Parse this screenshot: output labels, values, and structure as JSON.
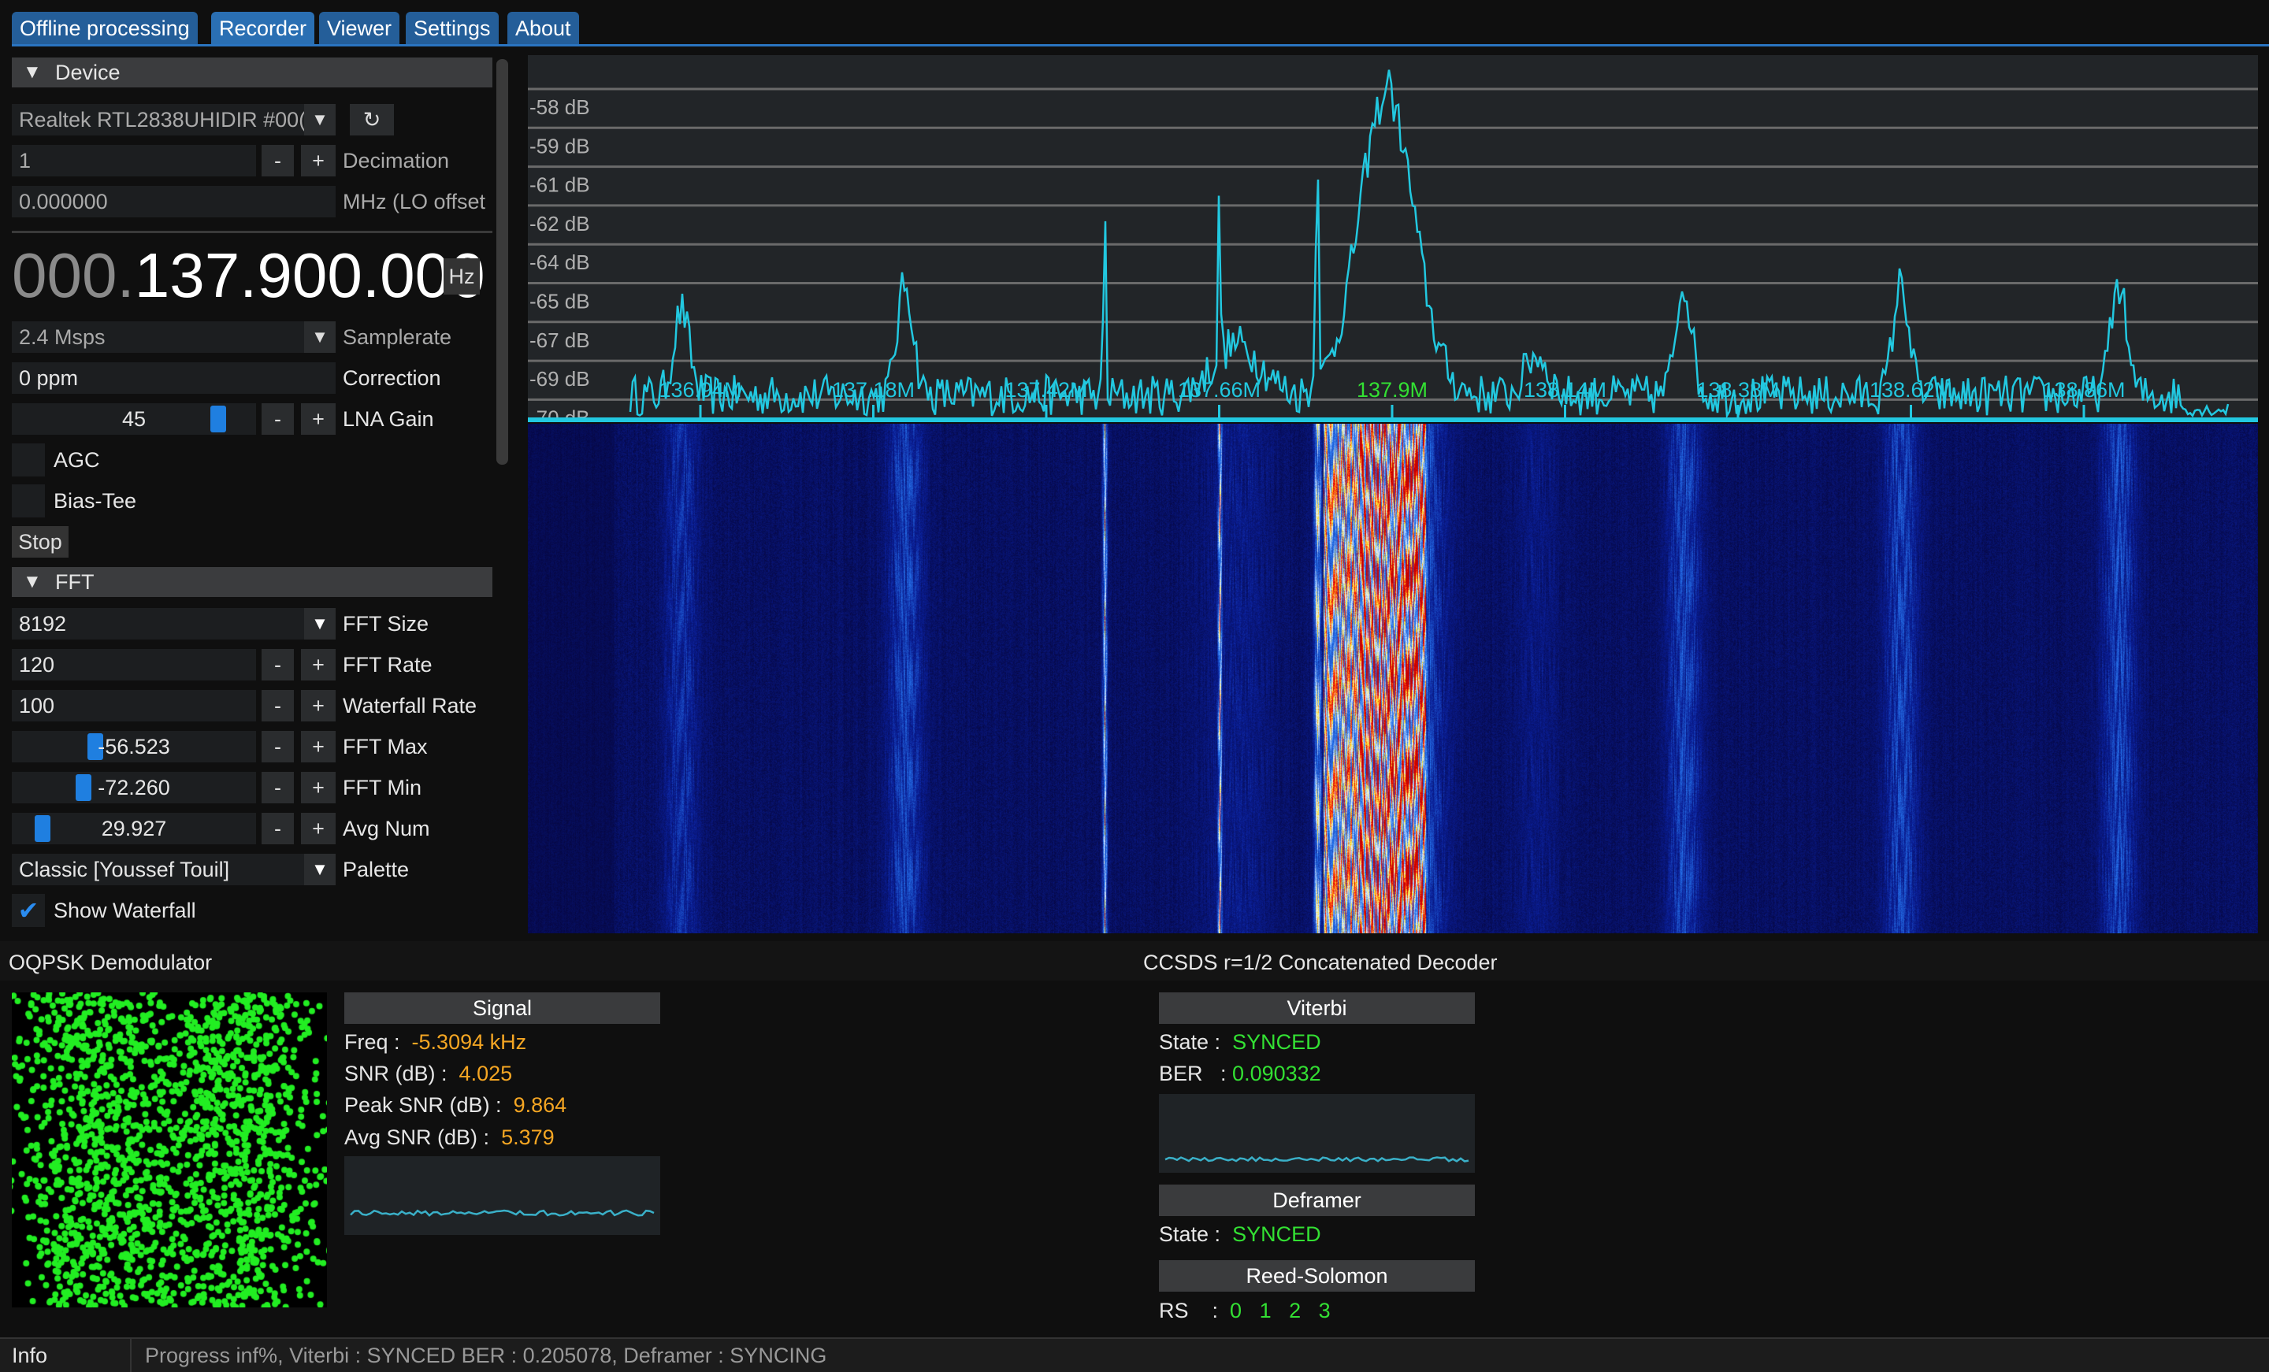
{
  "tabs": [
    {
      "label": "Offline processing"
    },
    {
      "label": "Recorder"
    },
    {
      "label": "Viewer"
    },
    {
      "label": "Settings"
    },
    {
      "label": "About"
    }
  ],
  "device": {
    "header": "Device",
    "source": "Realtek RTL2838UHIDIR #00(",
    "refresh_icon": "refresh-icon",
    "decimation": {
      "value": "1",
      "label": "Decimation"
    },
    "lo_offset": {
      "value": "0.000000",
      "label": "MHz (LO offset"
    },
    "frequency": {
      "leading": "000.",
      "main": "137.900.000",
      "unit": "Hz"
    },
    "samplerate": {
      "value": "2.4 Msps",
      "label": "Samplerate"
    },
    "correction": {
      "value": "0 ppm",
      "label": "Correction"
    },
    "lna_gain": {
      "value": "45",
      "label": "LNA Gain",
      "level": 0.87
    },
    "agc": {
      "label": "AGC",
      "checked": false
    },
    "bias_tee": {
      "label": "Bias-Tee",
      "checked": false
    },
    "stop_label": "Stop"
  },
  "fft": {
    "header": "FFT",
    "size": {
      "value": "8192",
      "label": "FFT Size"
    },
    "rate": {
      "value": "120",
      "label": "FFT Rate"
    },
    "waterfall_rate": {
      "value": "100",
      "label": "Waterfall Rate"
    },
    "max": {
      "value": "-56.523",
      "label": "FFT Max",
      "level": 0.33
    },
    "min": {
      "value": "-72.260",
      "label": "FFT Min",
      "level": 0.28
    },
    "avg": {
      "value": "29.927",
      "label": "Avg Num",
      "level": 0.1
    },
    "palette": {
      "value": "Classic [Youssef Touil]",
      "label": "Palette"
    },
    "show_waterfall": {
      "label": "Show Waterfall",
      "checked": true
    }
  },
  "spectrum": {
    "db_labels": [
      "-58 dB",
      "-59 dB",
      "-61 dB",
      "-62 dB",
      "-64 dB",
      "-65 dB",
      "-67 dB",
      "-69 dB",
      "-70 dB"
    ],
    "freq_labels": [
      "136.94M",
      "137.18M",
      "137.42M",
      "137.66M",
      "137.9M",
      "138.14M",
      "138.38M",
      "138.62M",
      "138.86M"
    ],
    "center_label_index": 4,
    "line_color": "#22c8e0",
    "center_color": "#33e033"
  },
  "demod": {
    "title": "OQPSK Demodulator",
    "signal_label": "Signal",
    "rows": [
      {
        "key": "Freq :",
        "value": "-5.3094 kHz"
      },
      {
        "key": "SNR (dB) :",
        "value": "4.025"
      },
      {
        "key": "Peak SNR (dB) :",
        "value": "9.864"
      },
      {
        "key": "Avg SNR (dB) :",
        "value": "5.379"
      }
    ]
  },
  "decoder": {
    "title": "CCSDS r=1/2 Concatenated Decoder",
    "viterbi_label": "Viterbi",
    "viterbi_state_key": "State :",
    "viterbi_state": "SYNCED",
    "ber_key": "BER   :",
    "ber": "0.090332",
    "deframer_label": "Deframer",
    "deframer_state_key": "State :",
    "deframer_state": "SYNCED",
    "rs_label": "Reed-Solomon",
    "rs_key": "RS    :",
    "rs_values": [
      "0",
      "1",
      "2",
      "3"
    ]
  },
  "status": {
    "label": "Info",
    "text": "Progress inf%, Viterbi : SYNCED BER : 0.205078, Deframer : SYNCING"
  },
  "colors": {
    "accent": "#245e99",
    "synced": "#33e033",
    "value": "#f5a623",
    "constellation": "#22ee22"
  }
}
